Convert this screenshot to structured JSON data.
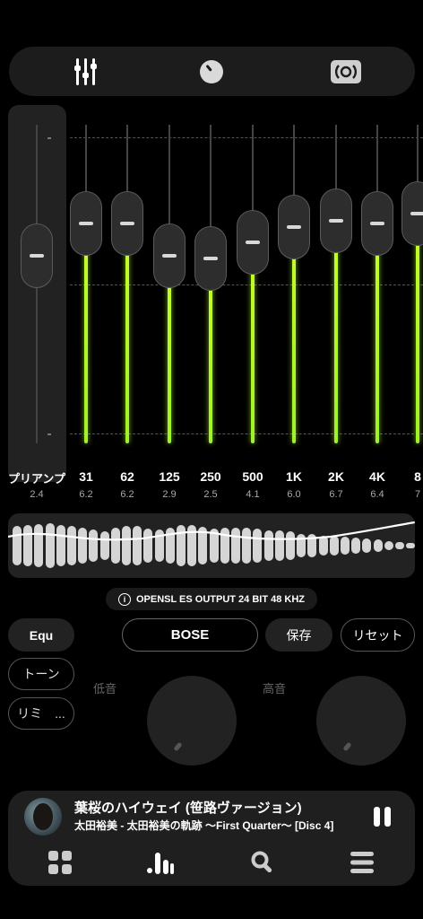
{
  "top_tabs": [
    {
      "name": "equalizer-icon"
    },
    {
      "name": "knob-icon"
    },
    {
      "name": "speaker-icon"
    }
  ],
  "preamp": {
    "label": "プリアンプ",
    "value": "2.4",
    "level": 0.41
  },
  "bands": [
    {
      "freq": "31",
      "value": "6.2",
      "level": 0.31
    },
    {
      "freq": "62",
      "value": "6.2",
      "level": 0.31
    },
    {
      "freq": "125",
      "value": "2.9",
      "level": 0.41
    },
    {
      "freq": "250",
      "value": "2.5",
      "level": 0.42
    },
    {
      "freq": "500",
      "value": "4.1",
      "level": 0.37
    },
    {
      "freq": "1K",
      "value": "6.0",
      "level": 0.32
    },
    {
      "freq": "2K",
      "value": "6.7",
      "level": 0.3
    },
    {
      "freq": "4K",
      "value": "6.4",
      "level": 0.31
    },
    {
      "freq": "8",
      "value": "7",
      "level": 0.28
    }
  ],
  "spectrum_levels": [
    0.72,
    0.78,
    0.8,
    0.82,
    0.78,
    0.74,
    0.66,
    0.6,
    0.54,
    0.66,
    0.74,
    0.74,
    0.62,
    0.6,
    0.66,
    0.78,
    0.76,
    0.7,
    0.64,
    0.66,
    0.66,
    0.66,
    0.62,
    0.58,
    0.56,
    0.52,
    0.44,
    0.42,
    0.38,
    0.36,
    0.34,
    0.3,
    0.26,
    0.22,
    0.18,
    0.14,
    0.1
  ],
  "output_info": "OPENSL ES OUTPUT  24 BIT  48 KHZ",
  "buttons": {
    "equ": "Equ",
    "preset": "BOSE",
    "save": "保存",
    "reset": "リセット",
    "tone": "トーン",
    "limiter": "リミ　..."
  },
  "dials": {
    "bass_label": "低音",
    "treble_label": "高音"
  },
  "player": {
    "title": "葉桜のハイウェイ (笹路ヴァージョン)",
    "artist": "太田裕美 - 太田裕美の軌跡 〜First Quarter〜 [Disc 4]"
  },
  "bottom_nav": [
    "grid-icon",
    "bars-icon",
    "search-icon",
    "menu-icon"
  ],
  "colors": {
    "accent": "#b7ff2a",
    "background": "#000000",
    "panel": "#1f1f1f"
  }
}
